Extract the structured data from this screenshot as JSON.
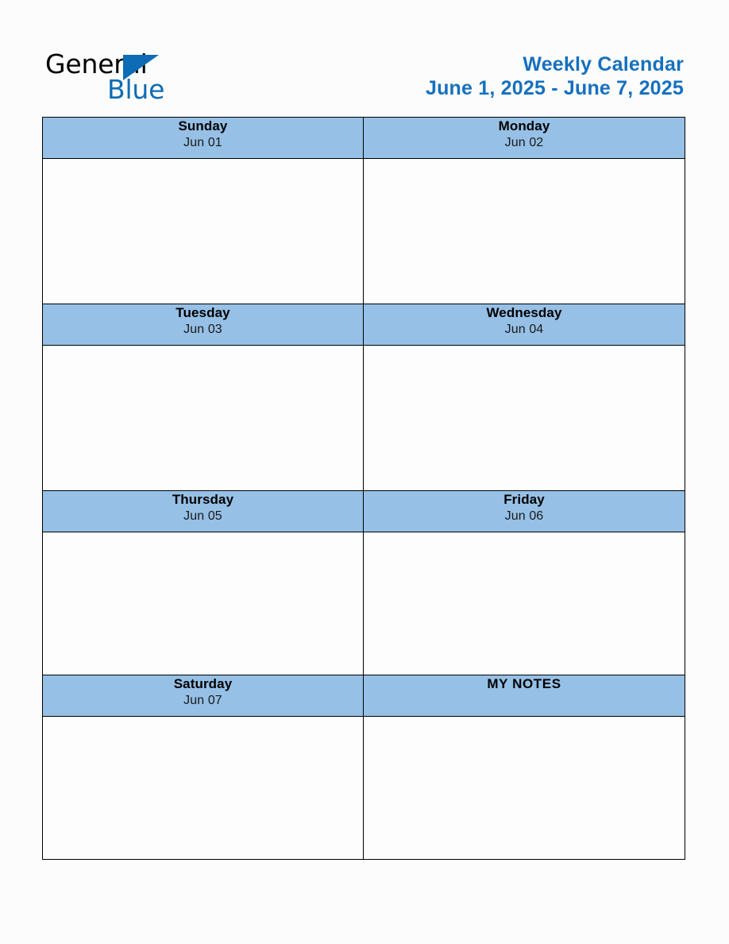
{
  "brand": {
    "name_dark": "General",
    "name_blue": "Blue",
    "logo_icon": "triangle-logo-icon",
    "accent_color": "#0d6cb5"
  },
  "header": {
    "title": "Weekly Calendar",
    "date_range": "June 1, 2025 - June 7, 2025",
    "title_color": "#1570be"
  },
  "calendar": {
    "header_background": "#96c0e6",
    "border_color": "#000000",
    "rows": [
      {
        "left": {
          "day": "Sunday",
          "date": "Jun 01"
        },
        "right": {
          "day": "Monday",
          "date": "Jun 02"
        }
      },
      {
        "left": {
          "day": "Tuesday",
          "date": "Jun 03"
        },
        "right": {
          "day": "Wednesday",
          "date": "Jun 04"
        }
      },
      {
        "left": {
          "day": "Thursday",
          "date": "Jun 05"
        },
        "right": {
          "day": "Friday",
          "date": "Jun 06"
        }
      },
      {
        "left": {
          "day": "Saturday",
          "date": "Jun 07"
        },
        "right": {
          "day": "MY NOTES",
          "date": ""
        }
      }
    ],
    "notes_label": "MY NOTES"
  }
}
